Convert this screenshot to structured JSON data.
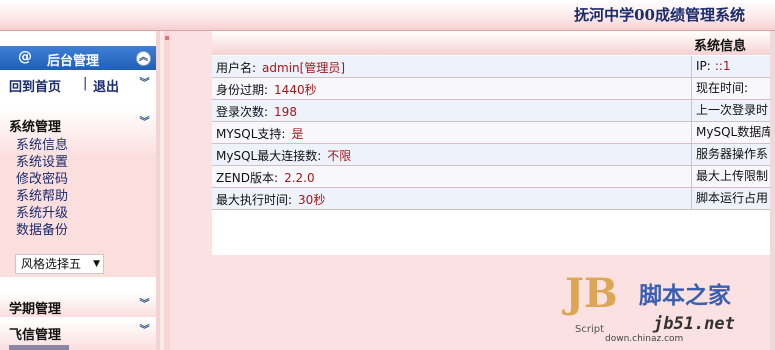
{
  "header": {
    "system_title": "抚河中学00成绩管理系统"
  },
  "sidebar": {
    "title": "后台管理",
    "title_icon": "@",
    "quick_links": {
      "home": "回到首页",
      "separator": "|",
      "logout": "退出"
    },
    "system_panel": {
      "title": "系统管理",
      "items": [
        "系统信息",
        "系统设置",
        "修改密码",
        "系统帮助",
        "系统升级",
        "数据备份"
      ],
      "style_select": {
        "value": "风格选择五"
      }
    },
    "term_panel": {
      "title": "学期管理"
    },
    "fx_panel": {
      "title": "飞信管理"
    }
  },
  "main": {
    "section_title": "系统信息",
    "rows": [
      {
        "key": "用户名:",
        "value": "admin[管理员]",
        "right_key": "IP:",
        "right_value": "::1"
      },
      {
        "key": "身份过期:",
        "value": "1440秒",
        "right_key": "现在时间:",
        "right_value": ""
      },
      {
        "key": "登录次数:",
        "value": "198",
        "right_key": "上一次登录时",
        "right_value": ""
      },
      {
        "key": "MYSQL支持:",
        "value": "是",
        "right_key": "MySQL数据库",
        "right_value": ""
      },
      {
        "key": "MySQL最大连接数:",
        "value": "不限",
        "right_key": "服务器操作系",
        "right_value": ""
      },
      {
        "key": "ZEND版本:",
        "value": "2.2.0",
        "right_key": "最大上传限制",
        "right_value": ""
      },
      {
        "key": "最大执行时间:",
        "value": "30秒",
        "right_key": "脚本运行占用",
        "right_value": ""
      }
    ]
  },
  "watermark": {
    "logo": "JB",
    "logo_sub": "Script",
    "cn": "脚本之家",
    "en": "jb51.net",
    "url": "down.chinaz.com"
  },
  "icons": {
    "collapse": "chevron-double-up-icon",
    "expand": "chevron-double-down-icon",
    "dropdown": "triangle-down-icon"
  }
}
